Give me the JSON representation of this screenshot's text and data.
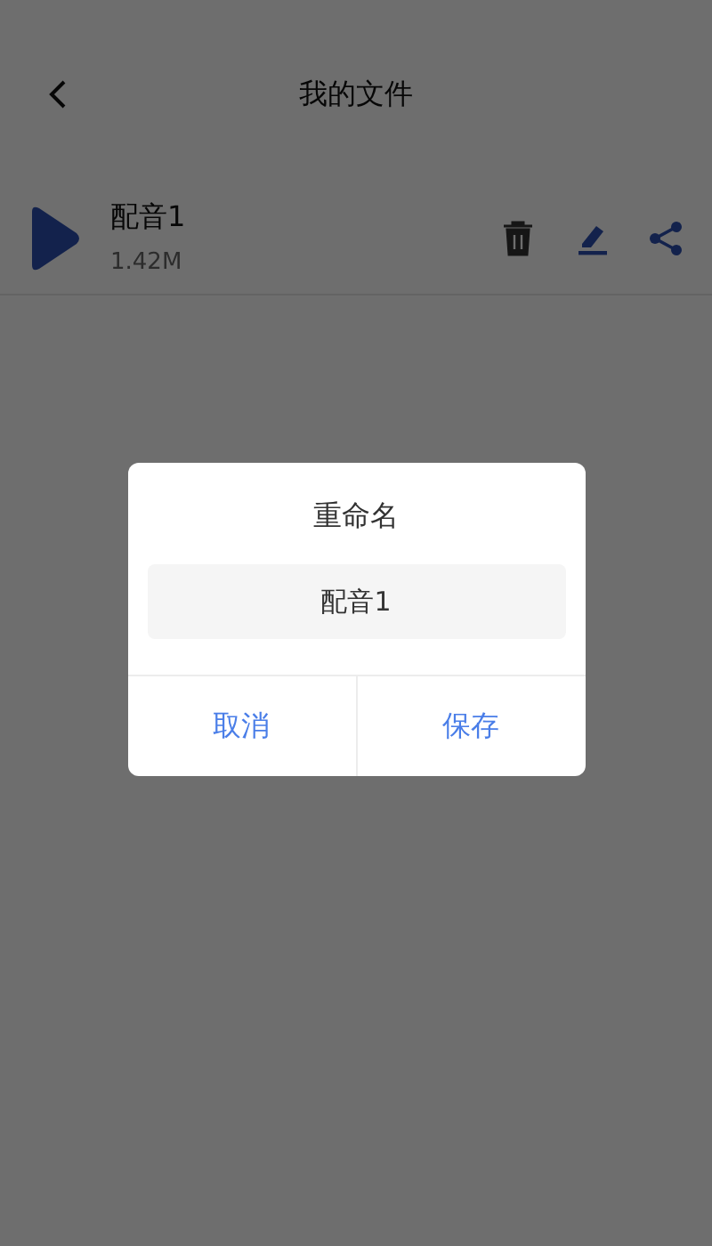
{
  "header": {
    "title": "我的文件"
  },
  "files": [
    {
      "name": "配音1",
      "size": "1.42M"
    }
  ],
  "dialog": {
    "title": "重命名",
    "value": "配音1",
    "buttons": [
      "取消",
      "保存"
    ]
  }
}
